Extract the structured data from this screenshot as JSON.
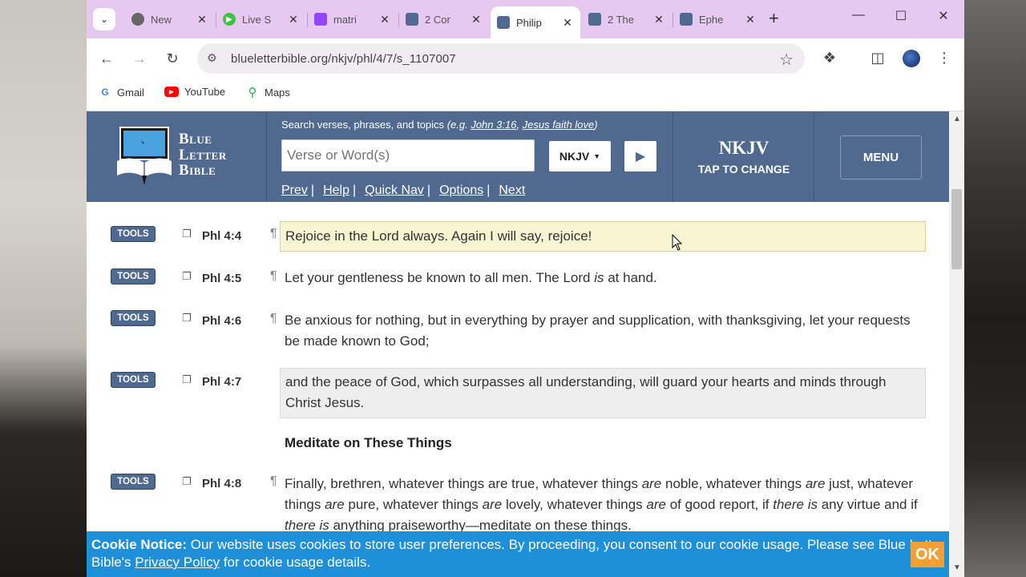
{
  "tabs": [
    {
      "title": "New",
      "favicon": "chrome-icon",
      "color": "#555555",
      "active": false
    },
    {
      "title": "Live S",
      "favicon": "play-icon",
      "color": "#3cc43c",
      "active": false
    },
    {
      "title": "matri",
      "favicon": "twitch-icon",
      "color": "#9146ff",
      "active": false
    },
    {
      "title": "2 Cor",
      "favicon": "blb-icon",
      "color": "#50698f",
      "active": false
    },
    {
      "title": "Philip",
      "favicon": "blb-icon",
      "color": "#50698f",
      "active": true
    },
    {
      "title": "2 The",
      "favicon": "blb-icon",
      "color": "#50698f",
      "active": false
    },
    {
      "title": "Ephe",
      "favicon": "blb-icon",
      "color": "#50698f",
      "active": false
    }
  ],
  "toolbar": {
    "url": "blueletterbible.org/nkjv/phl/4/7/s_1107007"
  },
  "bookmarks": [
    {
      "label": "Gmail",
      "icon": "google-icon"
    },
    {
      "label": "YouTube",
      "icon": "youtube-icon"
    },
    {
      "label": "Maps",
      "icon": "maps-icon"
    }
  ],
  "header": {
    "logo_line1": "Blue",
    "logo_line2": "Letter",
    "logo_line3": "Bible",
    "search_hint": "Search verses, phrases, and topics",
    "search_eg_prefix": "(e.g. ",
    "search_eg_1": "John 3:16",
    "search_eg_sep": ", ",
    "search_eg_2": "Jesus faith love",
    "search_eg_suffix": ")",
    "search_placeholder": "Verse or Word(s)",
    "version_select": "NKJV",
    "nav": {
      "prev": "Prev",
      "help": "Help",
      "quick_nav": "Quick Nav",
      "options": "Options",
      "next": "Next"
    },
    "version_name": "NKJV",
    "version_tap": "TAP TO CHANGE",
    "menu": "MENU"
  },
  "verses": {
    "tools_label": "TOOLS",
    "v4": {
      "ref": "Phl 4:4",
      "text": "Rejoice in the Lord always. Again I will say, rejoice!"
    },
    "v5": {
      "ref": "Phl 4:5",
      "t1": "Let your gentleness be known to all men. The Lord ",
      "t2": "is",
      "t3": " at hand."
    },
    "v6": {
      "ref": "Phl 4:6",
      "text": "Be anxious for nothing, but in everything by prayer and supplication, with thanksgiving, let your requests be made known to God;"
    },
    "v7": {
      "ref": "Phl 4:7",
      "text": "and the peace of God, which surpasses all understanding, will guard your hearts and minds through Christ Jesus."
    },
    "heading": "Meditate on These Things",
    "v8": {
      "ref": "Phl 4:8",
      "a": "Finally, brethren, whatever things are true, whatever things ",
      "b": "are",
      "c": " noble, whatever things ",
      "d": "are",
      "e": " just, whatever things ",
      "f": "are",
      "g": " pure, whatever things ",
      "h": "are",
      "i": " lovely, whatever things ",
      "j": "are",
      "k": " of good report, if ",
      "l": "there is",
      "m": " any virtue and if ",
      "n": "there is",
      "o": " anything praiseworthy—meditate on these things."
    }
  },
  "cookie": {
    "title": "Cookie Notice:",
    "text1": " Our website uses cookies to store user preferences. By proceeding, you consent to our cookie usage. Please see Blue Letter Bible's ",
    "link": "Privacy Policy",
    "text2": " for cookie usage details.",
    "ok": "OK"
  }
}
